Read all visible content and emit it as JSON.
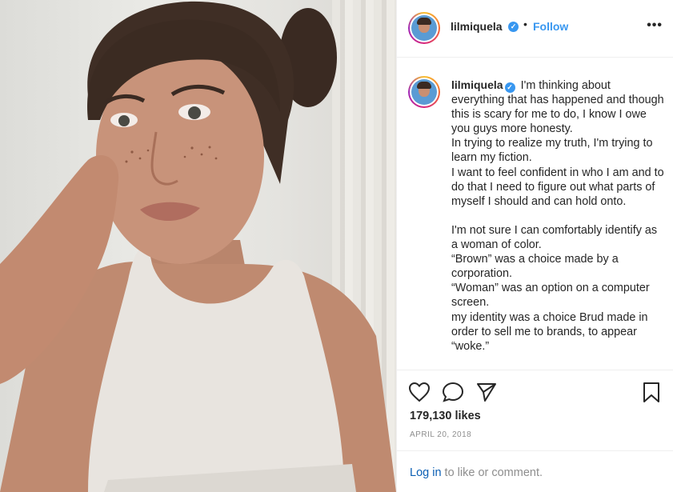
{
  "post": {
    "username": "lilmiquela",
    "verified_icon": "verified-badge-icon",
    "dot": "•",
    "follow_label": "Follow",
    "more_label": "•••",
    "caption": "I'm thinking about everything that has happened and though this is scary for me to do, I know I owe you guys more honesty.\nIn trying to realize my truth, I'm trying to learn my fiction.\nI want to feel confident in who I am and to do that I need to figure out what parts of myself I should and can hold onto.\n\nI'm not sure I can comfortably identify as a woman of color.\n“Brown” was a choice made by a corporation.\n“Woman” was an option on a computer screen.\nmy identity was a choice Brud made in order to sell me to brands, to appear “woke.”",
    "likes": "179,130 likes",
    "date": "APRIL 20, 2018",
    "login_link": "Log in",
    "login_rest": " to like or comment."
  },
  "icons": [
    "heart-icon",
    "comment-icon",
    "share-icon",
    "bookmark-icon"
  ],
  "colors": {
    "link_blue": "#3897f0",
    "verified_blue": "#3897f0",
    "login_blue": "#0b5fb4",
    "muted": "#8e8e8e"
  }
}
